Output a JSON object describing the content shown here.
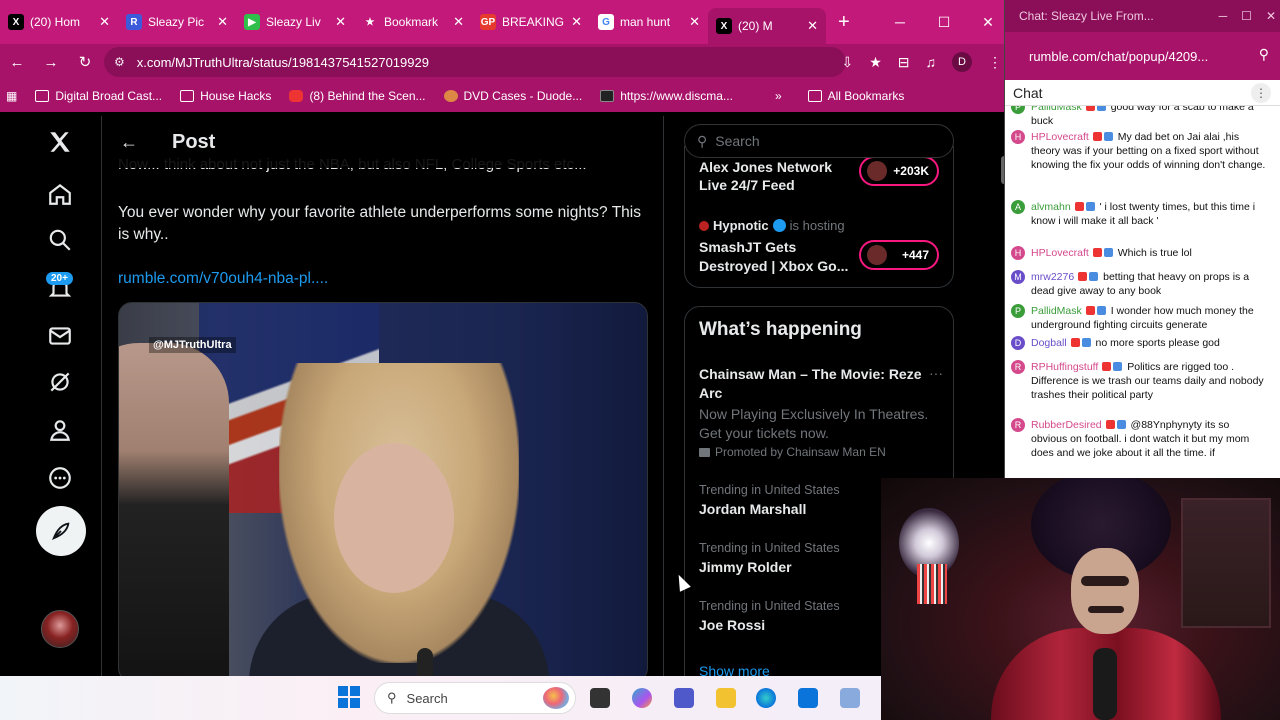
{
  "browser": {
    "tabs": [
      {
        "title": "(20) Hom",
        "fav": "X",
        "fav_color": "#000000",
        "active": false
      },
      {
        "title": "Sleazy Pic",
        "fav": "R",
        "fav_color": "#3b5bdb",
        "active": false
      },
      {
        "title": "Sleazy Liv",
        "fav": "▶",
        "fav_color": "#2fbf4a",
        "active": false
      },
      {
        "title": "Bookmark",
        "fav": "★",
        "fav_color": "#c3197a",
        "active": false
      },
      {
        "title": "BREAKING",
        "fav": "GP",
        "fav_color": "#e63a2e",
        "active": false
      },
      {
        "title": "man hunt",
        "fav": "G",
        "fav_color": "#ffffff",
        "active": false
      },
      {
        "title": "(20) M",
        "fav": "X",
        "fav_color": "#000000",
        "active": true
      }
    ],
    "url": "x.com/MJTruthUltra/status/1981437541527019929",
    "profile_initial": "D",
    "bookmarks": [
      {
        "label": "Digital Broad Cast...",
        "icon": "folder-icon"
      },
      {
        "label": "House Hacks",
        "icon": "folder-icon"
      },
      {
        "label": "(8) Behind the Scen...",
        "icon": "youtube-icon"
      },
      {
        "label": "DVD Cases - Duode...",
        "icon": "site-icon"
      },
      {
        "label": "https://www.discma...",
        "icon": "site-icon"
      }
    ],
    "all_bookmarks": "All Bookmarks",
    "accent": "#c3197a"
  },
  "x": {
    "header_title": "Post",
    "badge": "20+",
    "post_text_top": "Now... think about not just the NBA, but also NFL, College Sports etc...",
    "post_text_main": "You ever wonder why your favorite athlete underperforms some nights? This is why..",
    "post_link": "rumble.com/v70ouh4-nba-pl....",
    "video_watermark": "@MJTruthUltra",
    "search_placeholder": "Search",
    "live": {
      "item1_title": "Alex Jones Network Live 24/7 Feed",
      "item1_count": "+203K",
      "host_name": "Hypnotic",
      "host_suffix": "is hosting",
      "item2_title": "SmashJT Gets Destroyed | Xbox Go...",
      "item2_count": "+447"
    },
    "whats_happening": "What’s happening",
    "promo_title": "Chainsaw Man – The Movie: Reze Arc",
    "promo_more": "···",
    "promo_desc": "Now Playing Exclusively In Theatres. Get your tickets now.",
    "promo_by": "Promoted by Chainsaw Man EN",
    "trends": [
      {
        "context": "Trending in United States",
        "name": "Jordan Marshall"
      },
      {
        "context": "Trending in United States",
        "name": "Jimmy Rolder"
      },
      {
        "context": "Trending in United States",
        "name": "Joe Rossi"
      }
    ],
    "show_more": "Show more"
  },
  "chat": {
    "window_title": "Chat: Sleazy Live From...",
    "url": "rumble.com/chat/popup/4209...",
    "header": "Chat",
    "messages": [
      {
        "user": "PallidMask",
        "text": "good way for a scab to make a buck",
        "color": "#3a9d3a",
        "av": "P"
      },
      {
        "user": "HPLovecraft",
        "text": "My dad bet on Jai alai ,his theory was if your betting on a fixed sport without knowing the fix your odds of winning don't change.",
        "color": "#d4488c",
        "av": "H"
      },
      {
        "user": "alvmahn",
        "text": "' i lost twenty times, but this time i know i will make it all back '",
        "color": "#3a9d3a",
        "av": "A"
      },
      {
        "user": "HPLovecraft",
        "text": "Which is true lol",
        "color": "#d4488c",
        "av": "H"
      },
      {
        "user": "mrw2276",
        "text": "betting that heavy on props is a dead give away to any book",
        "color": "#6a4ec9",
        "av": "M"
      },
      {
        "user": "PallidMask",
        "text": "I wonder how much money the underground fighting circuits generate",
        "color": "#3a9d3a",
        "av": "P"
      },
      {
        "user": "Dogball",
        "text": "no more sports please god",
        "color": "#6a4ec9",
        "av": "D"
      },
      {
        "user": "RPHuffingstuff",
        "text": "Politics are rigged too . Difference is we trash our teams daily and nobody trashes their political party",
        "color": "#d4488c",
        "av": "R"
      },
      {
        "user": "RubberDesired",
        "text": "@88Ynphynyty its so obvious on football. i dont watch it but my mom does and we joke about it all the time. if",
        "color": "#d4488c",
        "av": "R"
      }
    ]
  },
  "taskbar": {
    "search_placeholder": "Search"
  }
}
